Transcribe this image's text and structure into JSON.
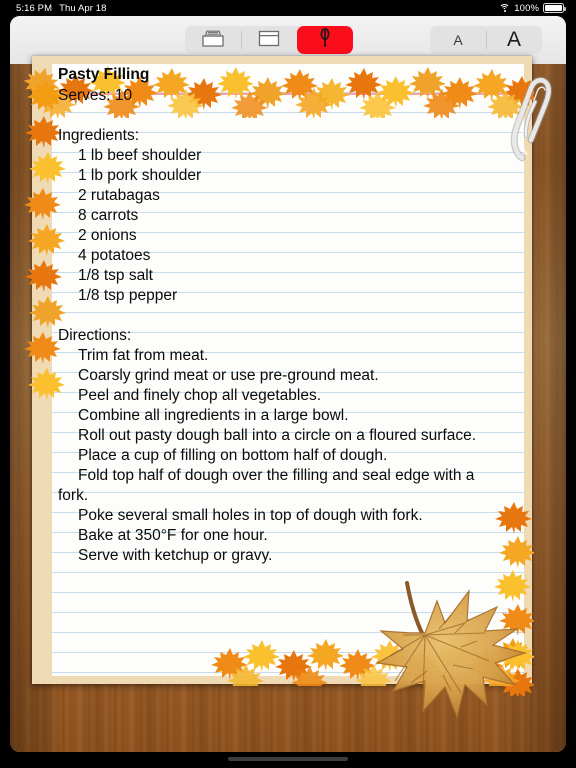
{
  "status_bar": {
    "time": "5:16 PM",
    "date": "Thu Apr 18",
    "battery_percent": "100%",
    "wifi_icon": "wifi-icon",
    "battery_icon": "battery-icon"
  },
  "toolbar": {
    "buttons": [
      {
        "name": "card-box-icon",
        "label": "",
        "selected": false
      },
      {
        "name": "note-window-icon",
        "label": "",
        "selected": false
      },
      {
        "name": "whisk-utensil-icon",
        "label": "",
        "selected": true
      }
    ],
    "font_buttons": [
      {
        "name": "decrease-font-size-button",
        "label": "A"
      },
      {
        "name": "increase-font-size-button",
        "label": "A"
      }
    ],
    "accent_color": "#fc0d1b"
  },
  "note": {
    "title": "Pasty Filling",
    "lines": [
      {
        "text": "Serves: 10",
        "indent": false
      },
      {
        "text": "",
        "indent": false
      },
      {
        "text": "Ingredients:",
        "indent": false
      },
      {
        "text": "1 lb beef shoulder",
        "indent": true
      },
      {
        "text": "1 lb pork shoulder",
        "indent": true
      },
      {
        "text": "2 rutabagas",
        "indent": true
      },
      {
        "text": "8 carrots",
        "indent": true
      },
      {
        "text": "2 onions",
        "indent": true
      },
      {
        "text": "4 potatoes",
        "indent": true
      },
      {
        "text": "1/8 tsp salt",
        "indent": true
      },
      {
        "text": "1/8 tsp pepper",
        "indent": true
      },
      {
        "text": "",
        "indent": false
      },
      {
        "text": "Directions:",
        "indent": false
      },
      {
        "text": "Trim fat from meat.",
        "indent": true
      },
      {
        "text": "Coarsly grind meat or use pre-ground meat.",
        "indent": true
      },
      {
        "text": "Peel and finely chop all vegetables.",
        "indent": true
      },
      {
        "text": "Combine all ingredients in a large bowl.",
        "indent": true
      },
      {
        "text": "Roll out pasty dough ball into a circle on a floured surface.",
        "indent": true
      },
      {
        "text": "Place a cup of filling on bottom half of dough.",
        "indent": true
      },
      {
        "text": "Fold top half of dough over the filling and seal edge with a",
        "indent": true
      },
      {
        "text": "fork.",
        "indent": false
      },
      {
        "text": "Poke several small holes in top of dough with fork.",
        "indent": true
      },
      {
        "text": "Bake at 350°F for one hour.",
        "indent": true
      },
      {
        "text": "Serve with ketchup or gravy.",
        "indent": true
      }
    ],
    "title_rule_color": "#f4a3a9",
    "rule_line_color": "#c9dcee",
    "paper_color": "#fdfdfb",
    "card_border_color": "#f0dab4"
  },
  "decorations": {
    "paperclip": "paperclip-icon",
    "maple_leaf": "maple-leaf-icon",
    "leaf_border": "leaf-border-decoration"
  }
}
